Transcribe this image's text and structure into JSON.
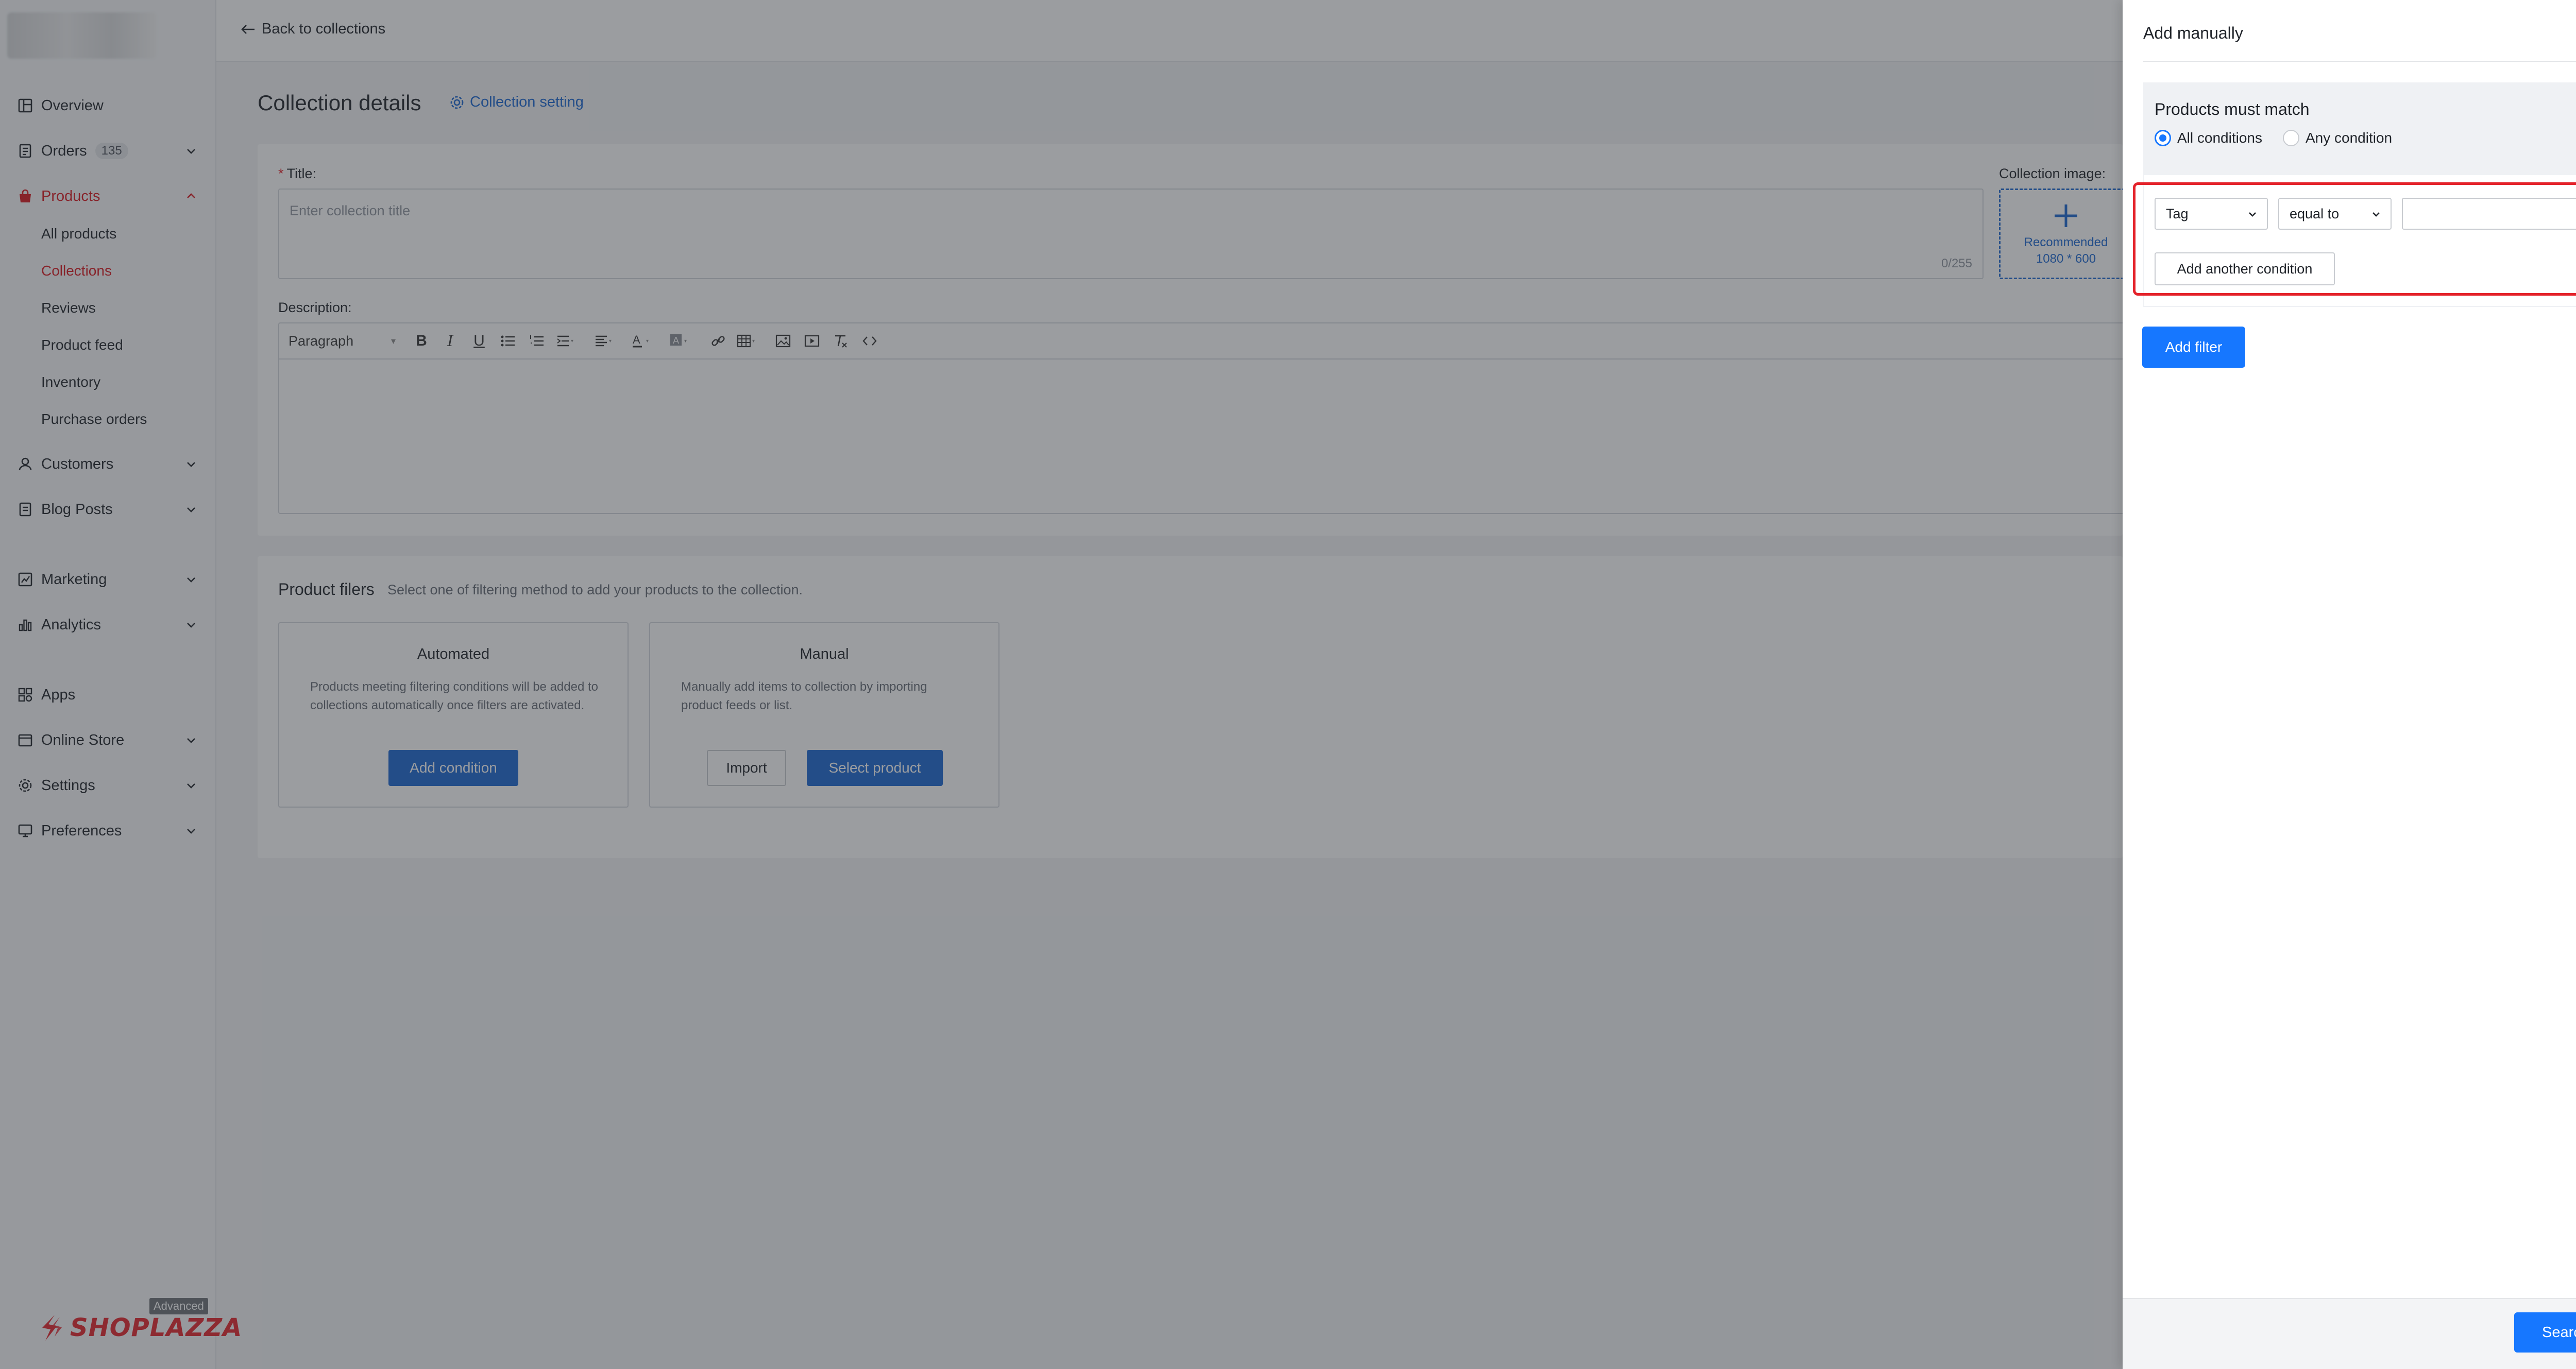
{
  "sidebar": {
    "items": [
      {
        "label": "Overview",
        "icon": "dashboard-icon"
      },
      {
        "label": "Orders",
        "icon": "orders-icon",
        "badge": "135"
      },
      {
        "label": "Products",
        "icon": "bag-icon"
      },
      {
        "label": "Customers",
        "icon": "user-icon"
      },
      {
        "label": "Blog Posts",
        "icon": "blog-icon"
      },
      {
        "label": "Marketing",
        "icon": "marketing-icon"
      },
      {
        "label": "Analytics",
        "icon": "analytics-icon"
      },
      {
        "label": "Apps",
        "icon": "apps-icon"
      },
      {
        "label": "Online Store",
        "icon": "store-icon"
      },
      {
        "label": "Settings",
        "icon": "gear-icon"
      },
      {
        "label": "Preferences",
        "icon": "monitor-icon"
      }
    ],
    "products_sub": [
      "All products",
      "Collections",
      "Reviews",
      "Product feed",
      "Inventory",
      "Purchase orders"
    ],
    "active_sub": "Collections",
    "brand": "SHOPLAZZA",
    "plan_tag": "Advanced"
  },
  "topbar": {
    "back_label": "Back to collections"
  },
  "main": {
    "page_title": "Collection details",
    "setting_link": "Collection setting",
    "title_label": "Title",
    "title_required": "*",
    "title_colon": ":",
    "title_placeholder": "Enter collection title",
    "title_count": "0/255",
    "image_label": "Collection image",
    "image_colon": ":",
    "image_rec_line1": "Recommended",
    "image_rec_line2": "1080 * 600",
    "description_label": "Description",
    "description_colon": ":",
    "editor_block_format": "Paragraph",
    "product_filters": {
      "title": "Product filers",
      "subtitle": "Select one of filtering method to add your products to the collection.",
      "automated": {
        "heading": "Automated",
        "description": "Products meeting filtering conditions will be added to collections automatically once filters are activated.",
        "button": "Add condition"
      },
      "manual": {
        "heading": "Manual",
        "description": "Manually add items to collection by importing product feeds or list.",
        "import_button": "Import",
        "select_button": "Select product"
      }
    }
  },
  "drawer": {
    "title": "Add manually",
    "match_title": "Products must match",
    "radio_all": "All conditions",
    "radio_any": "Any condition",
    "selected_radio": "All conditions",
    "condition_field": "Tag",
    "condition_operator": "equal to",
    "condition_value": "",
    "add_another": "Add another condition",
    "add_filter": "Add filter",
    "search": "Search"
  },
  "colors": {
    "brand_red": "#e4232b",
    "primary_blue": "#1677ff",
    "link_blue": "#1a66d2"
  }
}
